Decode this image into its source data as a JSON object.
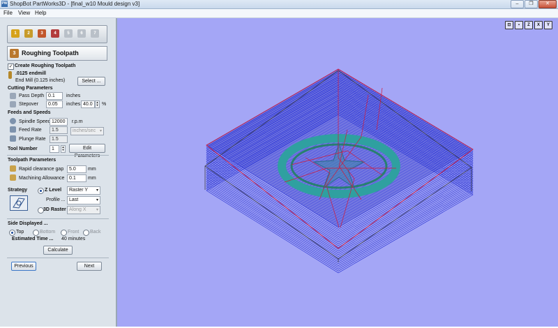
{
  "window": {
    "title": "ShopBot PartWorks3D - [final_w10 Mould design v3]",
    "app_icon": "PW",
    "minimize": "–",
    "maximize": "❐",
    "close": "✕"
  },
  "menu": [
    "File",
    "View",
    "Help"
  ],
  "stages": [
    {
      "label": "1",
      "color": "#d6a21a"
    },
    {
      "label": "2",
      "color": "#c79b2b"
    },
    {
      "label": "3",
      "color": "#c2562b"
    },
    {
      "label": "4",
      "color": "#b23b3b"
    },
    {
      "label": "5",
      "color": "#b9c0c8"
    },
    {
      "label": "6",
      "color": "#b9c0c8"
    },
    {
      "label": "7",
      "color": "#b9c0c8"
    }
  ],
  "header": {
    "icon": "3",
    "title": "Roughing Toolpath"
  },
  "create_toolpath": {
    "checked": true,
    "label": "Create Roughing Toolpath"
  },
  "tool": {
    "name": ".0125 endmill",
    "desc": "End Mill (0.125 inches)",
    "select_label": "Select ..."
  },
  "cutting": {
    "title": "Cutting Parameters",
    "pass_depth_label": "Pass Depth",
    "pass_depth": "0.1",
    "pass_depth_unit": "inches",
    "stepover_label": "Stepover",
    "stepover": "0.05",
    "stepover_unit": "inches",
    "stepover_pct": "40.0",
    "pct_sign": "%"
  },
  "feeds": {
    "title": "Feeds and Speeds",
    "spindle_label": "Spindle Speed",
    "spindle": "12000",
    "spindle_unit": "r.p.m",
    "feed_label": "Feed Rate",
    "feed": "1.5",
    "feed_unit": "inches/sec",
    "plunge_label": "Plunge Rate",
    "plunge": "1.5"
  },
  "tool_number": {
    "label": "Tool Number",
    "value": "1",
    "edit_label": "Edit Parameters"
  },
  "toolpath": {
    "title": "Toolpath Parameters",
    "rapid_label": "Rapid clearance gap",
    "rapid": "5.0",
    "rapid_unit": "mm",
    "allowance_label": "Machining Allowance",
    "allowance": "0.1",
    "allowance_unit": "mm"
  },
  "strategy": {
    "label": "Strategy",
    "zlevel_label": "Z Level",
    "zlevel_selected": true,
    "zlevel_option": "Raster Y",
    "profile_label": "Profile ...",
    "profile_option": "Last",
    "raster3d_label": "3D Raster",
    "raster3d_option": "Along X"
  },
  "side": {
    "title": "Side Displayed ...",
    "options": [
      "Top",
      "Bottom",
      "Front",
      "Back"
    ],
    "selected": "Top"
  },
  "estimate": {
    "label": "Estimated Time ...",
    "value": "40 minutes"
  },
  "calculate_label": "Calculate",
  "previous_label": "Previous",
  "next_label": "Next",
  "view_buttons": [
    "⊡",
    "▪",
    "Z",
    "X",
    "Y"
  ]
}
